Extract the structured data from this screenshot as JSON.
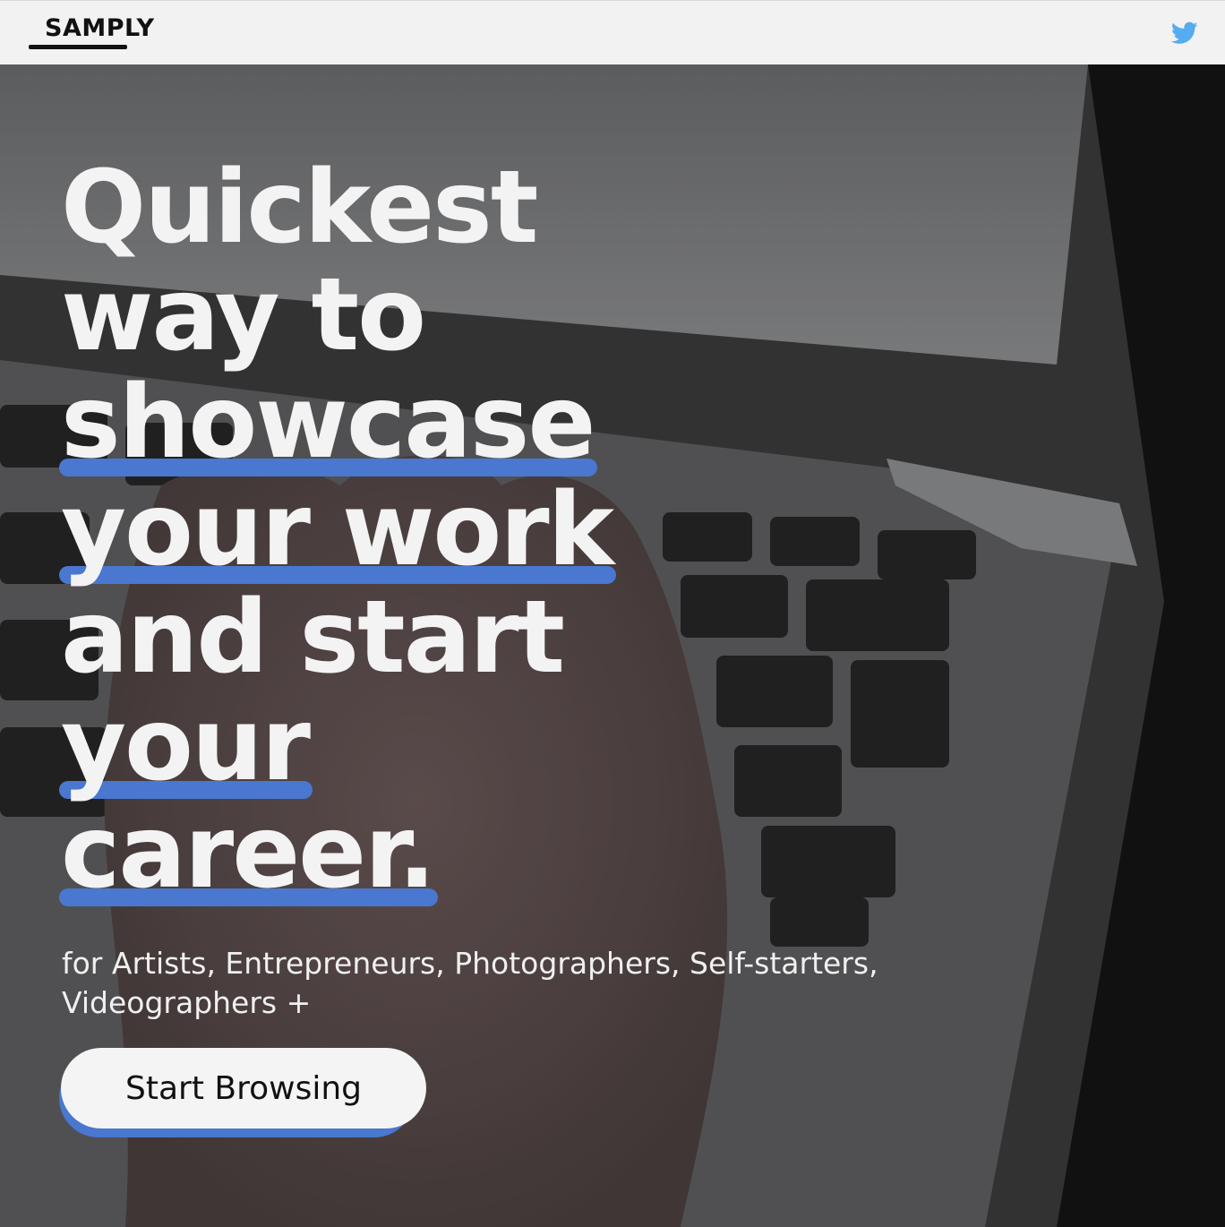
{
  "header": {
    "logo_text": "SAMPLY",
    "social_icon": "twitter-icon",
    "social_icon_color": "#55acee"
  },
  "hero": {
    "headline_lines": [
      {
        "text": "Quickest",
        "underlined": false
      },
      {
        "text": "way to",
        "underlined": false
      },
      {
        "text": "showcase",
        "underlined": true
      },
      {
        "text": "your work",
        "underlined": true
      },
      {
        "text": "and start",
        "underlined": false
      },
      {
        "text": "your",
        "underlined": true
      },
      {
        "text": "career.",
        "underlined": true
      }
    ],
    "subtitle": "for Artists, Entrepreneurs, Photographers, Self-starters, Videographers +",
    "cta_label": "Start Browsing",
    "accent_color": "#4a77cf",
    "background_image": "hand-typing-on-laptop-keyboard"
  }
}
